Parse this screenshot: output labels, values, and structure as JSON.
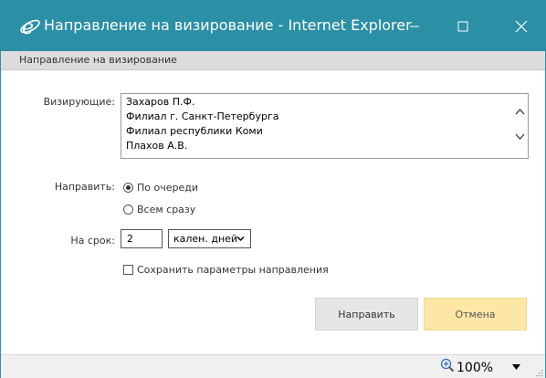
{
  "window": {
    "title": "Направление на визирование - Internet Explorer",
    "accent_color": "#2b8fa6",
    "icons": {
      "app": "internet-explorer-icon",
      "minimize": "minimize-icon",
      "maximize": "maximize-icon",
      "close": "close-icon"
    }
  },
  "dialog": {
    "header": "Направление на визирование",
    "approvers": {
      "label": "Визирующие:",
      "items": [
        "Захаров П.Ф.",
        "Филиал г. Санкт-Петербурга",
        "Филиал республики Коми",
        "Плахов А.В."
      ]
    },
    "send_mode": {
      "label": "Направить:",
      "options": [
        "По очереди",
        "Всем сразу"
      ],
      "selected": "По очереди"
    },
    "term": {
      "label": "На срок:",
      "value": "2",
      "unit_selected": "кален. дней"
    },
    "save_params": {
      "label": "Сохранить параметры направления",
      "checked": false
    },
    "buttons": {
      "send": "Направить",
      "cancel": "Отмена",
      "cancel_color": "#fde7a6"
    }
  },
  "statusbar": {
    "zoom": "100%"
  }
}
